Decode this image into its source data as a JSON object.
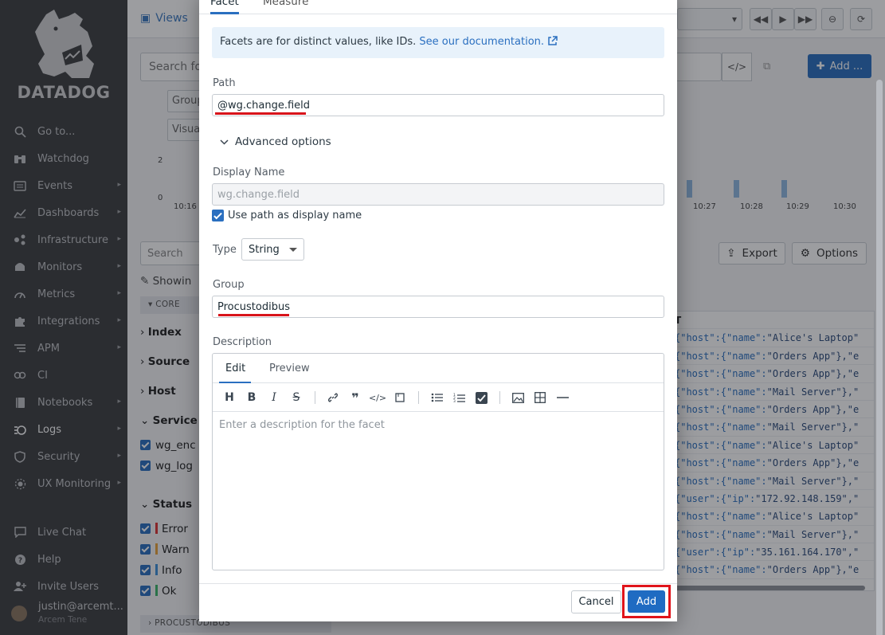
{
  "sidebar": {
    "logo_text": "DATADOG",
    "items": [
      {
        "label": "Go to...",
        "icon": "search-icon",
        "chevron": false
      },
      {
        "label": "Watchdog",
        "icon": "binoculars-icon",
        "chevron": false
      },
      {
        "label": "Events",
        "icon": "events-icon",
        "chevron": true
      },
      {
        "label": "Dashboards",
        "icon": "dashboard-icon",
        "chevron": true
      },
      {
        "label": "Infrastructure",
        "icon": "infrastructure-icon",
        "chevron": true
      },
      {
        "label": "Monitors",
        "icon": "monitors-icon",
        "chevron": true
      },
      {
        "label": "Metrics",
        "icon": "metrics-icon",
        "chevron": true
      },
      {
        "label": "Integrations",
        "icon": "puzzle-icon",
        "chevron": true
      },
      {
        "label": "APM",
        "icon": "apm-icon",
        "chevron": true
      },
      {
        "label": "CI",
        "icon": "ci-icon",
        "chevron": true
      },
      {
        "label": "Notebooks",
        "icon": "notebooks-icon",
        "chevron": true
      },
      {
        "label": "Logs",
        "icon": "logs-icon",
        "chevron": true
      },
      {
        "label": "Security",
        "icon": "shield-icon",
        "chevron": true
      },
      {
        "label": "UX Monitoring",
        "icon": "ux-monitoring-icon",
        "chevron": true
      }
    ],
    "bottom_items": [
      {
        "label": "Live Chat",
        "icon": "chat-icon"
      },
      {
        "label": "Help",
        "icon": "help-icon"
      },
      {
        "label": "Invite Users",
        "icon": "invite-users-icon"
      }
    ],
    "user_name": "justin@arcemt...",
    "user_org": "Arcem Tene"
  },
  "background": {
    "views_label": "Views",
    "search_placeholder": "Search fo",
    "add_label": "Add ...",
    "group_label": "Group",
    "visual_label": "Visua",
    "chart": {
      "y_ticks": [
        "2",
        "0"
      ],
      "x_ticks": [
        "10:16",
        "10:27",
        "10:28",
        "10:29",
        "10:30"
      ]
    },
    "export_label": "Export",
    "options_label": "Options",
    "facet_search_placeholder": "Search",
    "showing_label": "Showin",
    "core_label": "CORE",
    "facets": [
      "Index",
      "Source",
      "Host",
      "Service"
    ],
    "service_values": [
      "wg_enc",
      "wg_log"
    ],
    "status_label": "Status",
    "status_values": [
      "Error",
      "Warn",
      "Info",
      "Ok"
    ],
    "procustodibus_label": "PROCUSTODIBUS",
    "log_header": "T",
    "log_lines": [
      [
        "host",
        "name",
        "\"Alice's Laptop\""
      ],
      [
        "host",
        "name",
        "\"Orders App\"},\"e"
      ],
      [
        "host",
        "name",
        "\"Orders App\"},\"e"
      ],
      [
        "host",
        "name",
        "\"Mail Server\"},\""
      ],
      [
        "host",
        "name",
        "\"Orders App\"},\"e"
      ],
      [
        "host",
        "name",
        "\"Mail Server\"},\""
      ],
      [
        "host",
        "name",
        "\"Alice's Laptop\""
      ],
      [
        "host",
        "name",
        "\"Orders App\"},\"e"
      ],
      [
        "host",
        "name",
        "\"Mail Server\"},\""
      ],
      [
        "user",
        "ip",
        "\"172.92.148.159\",\""
      ],
      [
        "host",
        "name",
        "\"Alice's Laptop\""
      ],
      [
        "host",
        "name",
        "\"Mail Server\"},\""
      ],
      [
        "user",
        "ip",
        "\"35.161.164.170\",\""
      ],
      [
        "host",
        "name",
        "\"Orders App\"},\"e"
      ]
    ]
  },
  "modal": {
    "tabs": [
      "Facet",
      "Measure"
    ],
    "info_text": "Facets are for distinct values, like IDs.",
    "info_link": "See our documentation.",
    "path_label": "Path",
    "path_value": "@wg.change.field",
    "advanced_label": "Advanced options",
    "display_name_label": "Display Name",
    "display_name_placeholder": "wg.change.field",
    "use_path_label": "Use path as display name",
    "type_label": "Type",
    "type_value": "String",
    "group_label": "Group",
    "group_value": "Procustodibus",
    "description_label": "Description",
    "editor_tabs": [
      "Edit",
      "Preview"
    ],
    "editor_placeholder": "Enter a description for the facet",
    "cancel_label": "Cancel",
    "add_label": "Add"
  },
  "colors": {
    "accent": "#1f6bc2",
    "highlight": "#e0141b",
    "sidebar_bg": "#3d3e41"
  }
}
